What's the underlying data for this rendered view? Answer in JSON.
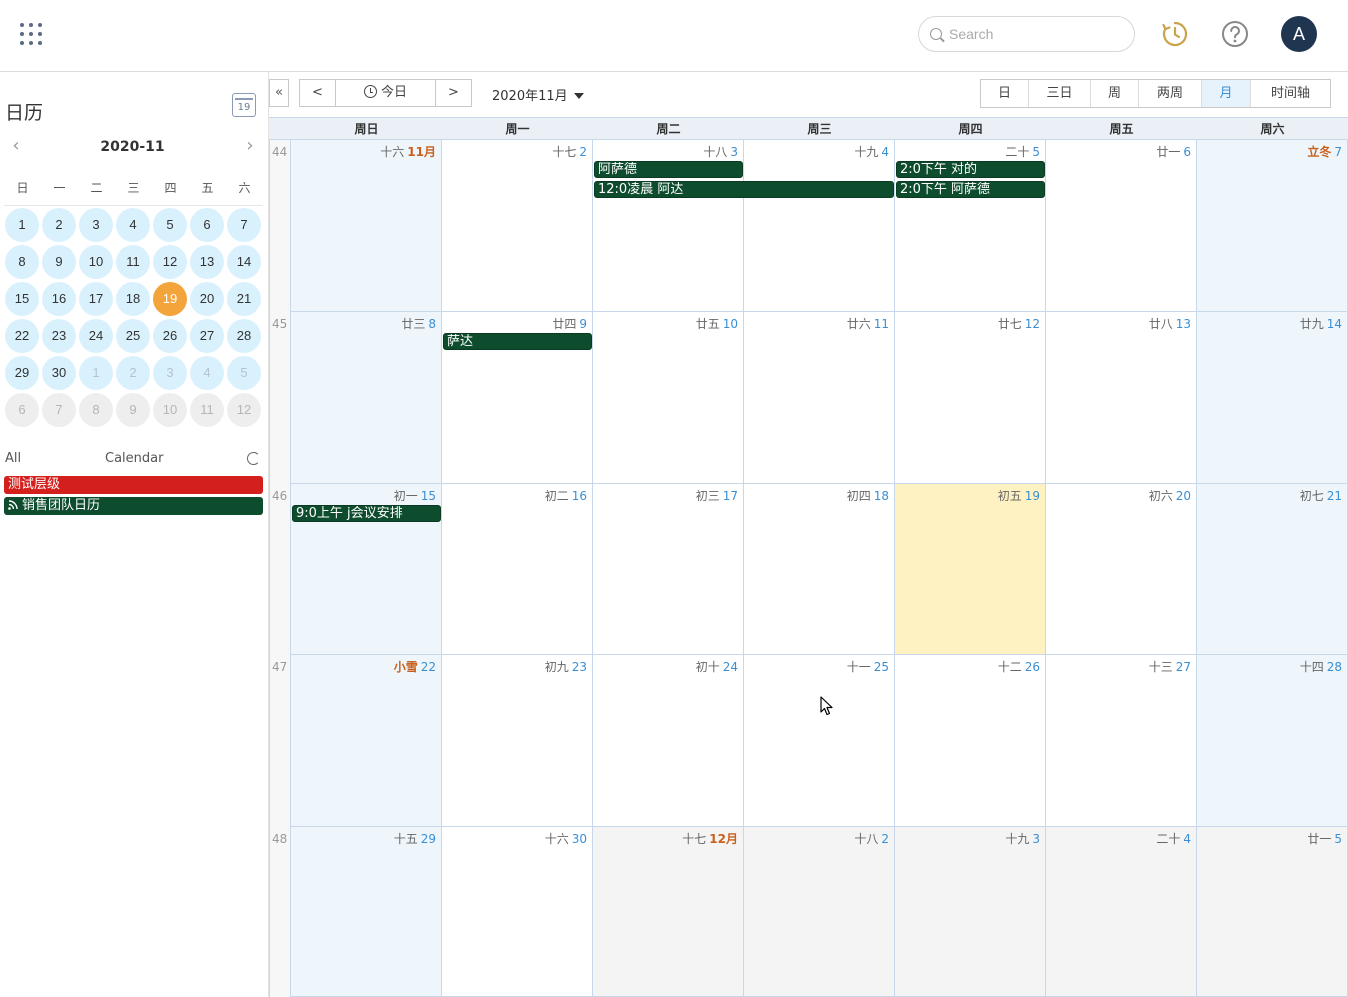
{
  "header": {
    "search_placeholder": "Search",
    "avatar_initial": "A",
    "accent_color": "#f3a43a"
  },
  "sidebar": {
    "title": "日历",
    "cal_icon_text": "19",
    "mini_title": "2020-11",
    "weekdays": [
      "日",
      "一",
      "二",
      "三",
      "四",
      "五",
      "六"
    ],
    "days": [
      {
        "n": "1",
        "t": "cur"
      },
      {
        "n": "2",
        "t": "cur"
      },
      {
        "n": "3",
        "t": "cur"
      },
      {
        "n": "4",
        "t": "cur"
      },
      {
        "n": "5",
        "t": "cur"
      },
      {
        "n": "6",
        "t": "cur"
      },
      {
        "n": "7",
        "t": "cur"
      },
      {
        "n": "8",
        "t": "cur"
      },
      {
        "n": "9",
        "t": "cur"
      },
      {
        "n": "10",
        "t": "cur"
      },
      {
        "n": "11",
        "t": "cur"
      },
      {
        "n": "12",
        "t": "cur"
      },
      {
        "n": "13",
        "t": "cur"
      },
      {
        "n": "14",
        "t": "cur"
      },
      {
        "n": "15",
        "t": "cur"
      },
      {
        "n": "16",
        "t": "cur"
      },
      {
        "n": "17",
        "t": "cur"
      },
      {
        "n": "18",
        "t": "cur"
      },
      {
        "n": "19",
        "t": "today"
      },
      {
        "n": "20",
        "t": "cur"
      },
      {
        "n": "21",
        "t": "cur"
      },
      {
        "n": "22",
        "t": "cur"
      },
      {
        "n": "23",
        "t": "cur"
      },
      {
        "n": "24",
        "t": "cur"
      },
      {
        "n": "25",
        "t": "cur"
      },
      {
        "n": "26",
        "t": "cur"
      },
      {
        "n": "27",
        "t": "cur"
      },
      {
        "n": "28",
        "t": "cur"
      },
      {
        "n": "29",
        "t": "cur"
      },
      {
        "n": "30",
        "t": "cur"
      },
      {
        "n": "1",
        "t": "next"
      },
      {
        "n": "2",
        "t": "next"
      },
      {
        "n": "3",
        "t": "next"
      },
      {
        "n": "4",
        "t": "next"
      },
      {
        "n": "5",
        "t": "next"
      },
      {
        "n": "6",
        "t": "later"
      },
      {
        "n": "7",
        "t": "later"
      },
      {
        "n": "8",
        "t": "later"
      },
      {
        "n": "9",
        "t": "later"
      },
      {
        "n": "10",
        "t": "later"
      },
      {
        "n": "11",
        "t": "later"
      },
      {
        "n": "12",
        "t": "later"
      }
    ],
    "list_all": "All",
    "list_calendar": "Calendar",
    "calendars": [
      {
        "label": "测试层级",
        "color": "#d4201c"
      },
      {
        "label": "销售团队日历",
        "color": "#0e4c2e"
      }
    ]
  },
  "toolbar": {
    "collapse": "«",
    "prev": "<",
    "today": "今日",
    "next": ">",
    "month_title": "2020年11月",
    "views": [
      {
        "label": "日",
        "active": false
      },
      {
        "label": "三日",
        "active": false
      },
      {
        "label": "周",
        "active": false
      },
      {
        "label": "两周",
        "active": false
      },
      {
        "label": "月",
        "active": true
      },
      {
        "label": "时间轴",
        "active": false
      }
    ]
  },
  "grid": {
    "day_headers": [
      "周日",
      "周一",
      "周二",
      "周三",
      "周四",
      "周五",
      "周六"
    ],
    "weeks": [
      {
        "num": "44",
        "days": [
          {
            "lunar": "十六",
            "date": "11月",
            "kind": "weekend",
            "dateMonth": true
          },
          {
            "lunar": "十七",
            "date": "2",
            "kind": ""
          },
          {
            "lunar": "十八",
            "date": "3",
            "kind": ""
          },
          {
            "lunar": "十九",
            "date": "4",
            "kind": ""
          },
          {
            "lunar": "二十",
            "date": "5",
            "kind": ""
          },
          {
            "lunar": "廿一",
            "date": "6",
            "kind": ""
          },
          {
            "lunar": "立冬",
            "date": "7",
            "kind": "weekend",
            "term": true
          }
        ]
      },
      {
        "num": "45",
        "days": [
          {
            "lunar": "廿三",
            "date": "8",
            "kind": "weekend"
          },
          {
            "lunar": "廿四",
            "date": "9",
            "kind": ""
          },
          {
            "lunar": "廿五",
            "date": "10",
            "kind": ""
          },
          {
            "lunar": "廿六",
            "date": "11",
            "kind": ""
          },
          {
            "lunar": "廿七",
            "date": "12",
            "kind": ""
          },
          {
            "lunar": "廿八",
            "date": "13",
            "kind": ""
          },
          {
            "lunar": "廿九",
            "date": "14",
            "kind": "weekend"
          }
        ]
      },
      {
        "num": "46",
        "days": [
          {
            "lunar": "初一",
            "date": "15",
            "kind": "weekend"
          },
          {
            "lunar": "初二",
            "date": "16",
            "kind": ""
          },
          {
            "lunar": "初三",
            "date": "17",
            "kind": ""
          },
          {
            "lunar": "初四",
            "date": "18",
            "kind": ""
          },
          {
            "lunar": "初五",
            "date": "19",
            "kind": "today"
          },
          {
            "lunar": "初六",
            "date": "20",
            "kind": ""
          },
          {
            "lunar": "初七",
            "date": "21",
            "kind": "weekend"
          }
        ]
      },
      {
        "num": "47",
        "days": [
          {
            "lunar": "小雪",
            "date": "22",
            "kind": "weekend",
            "term": true
          },
          {
            "lunar": "初九",
            "date": "23",
            "kind": ""
          },
          {
            "lunar": "初十",
            "date": "24",
            "kind": ""
          },
          {
            "lunar": "十一",
            "date": "25",
            "kind": ""
          },
          {
            "lunar": "十二",
            "date": "26",
            "kind": ""
          },
          {
            "lunar": "十三",
            "date": "27",
            "kind": ""
          },
          {
            "lunar": "十四",
            "date": "28",
            "kind": "weekend"
          }
        ]
      },
      {
        "num": "48",
        "days": [
          {
            "lunar": "十五",
            "date": "29",
            "kind": "weekend"
          },
          {
            "lunar": "十六",
            "date": "30",
            "kind": ""
          },
          {
            "lunar": "十七",
            "date": "12月",
            "kind": "other",
            "dateMonth": true
          },
          {
            "lunar": "十八",
            "date": "2",
            "kind": "other"
          },
          {
            "lunar": "十九",
            "date": "3",
            "kind": "other"
          },
          {
            "lunar": "二十",
            "date": "4",
            "kind": "other"
          },
          {
            "lunar": "廿一",
            "date": "5",
            "kind": "other"
          }
        ]
      }
    ],
    "events": [
      {
        "label": "阿萨德",
        "week": 0,
        "startDay": 2,
        "span": 1,
        "slot": 0
      },
      {
        "label": "12:0凌晨 阿达",
        "week": 0,
        "startDay": 2,
        "span": 2,
        "slot": 1
      },
      {
        "label": "2:0下午 对的",
        "week": 0,
        "startDay": 4,
        "span": 1,
        "slot": 0
      },
      {
        "label": "2:0下午 阿萨德",
        "week": 0,
        "startDay": 4,
        "span": 1,
        "slot": 1
      },
      {
        "label": "萨达",
        "week": 1,
        "startDay": 1,
        "span": 1,
        "slot": 0
      },
      {
        "label": "9:0上午 j会议安排",
        "week": 2,
        "startDay": 0,
        "span": 1,
        "slot": 0
      }
    ]
  }
}
